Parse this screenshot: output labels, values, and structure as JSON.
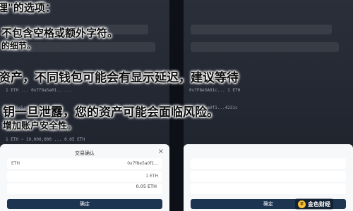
{
  "background_rows": {
    "address": "0x7f8e5a0f1...4231c",
    "amount": "1 ETH ~ 10,000,000 ... 0.05 ETH",
    "left_rows": [
      "1 ETH ... 0x7f8a5a01.. ..."
    ],
    "right_rows": [
      "0x7F8e5A01c... 1 ETH"
    ]
  },
  "modal": {
    "title": "交易确认",
    "close_icon": "×",
    "fields": [
      {
        "label": "ETH",
        "value": "0x7f8e5a0f1..."
      },
      {
        "label": "",
        "value": "1 ETH"
      },
      {
        "label": "",
        "value": ""
      }
    ],
    "fee": "0.05 ETH",
    "confirm_label": "确定"
  },
  "right_modal": {
    "confirm_label": "确定"
  },
  "overlay_text": {
    "line1": "理\"的选项：",
    "line2": "不包含空格或额外字符。",
    "line3": "的细节。",
    "line4": "资产，不同钱包可能会有显示延迟，建议等待",
    "line5": "钥一旦泄露，您的资产可能会面临风险。",
    "line6": "增加账户安全性。"
  },
  "watermark": {
    "text": "金色财经"
  }
}
